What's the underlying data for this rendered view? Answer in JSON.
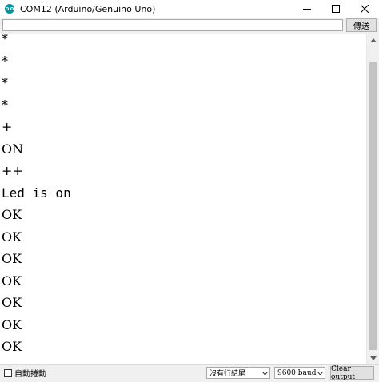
{
  "window": {
    "title": "COM12 (Arduino/Genuino Uno)",
    "controls": {
      "minimize": "—",
      "maximize": "☐",
      "close": "✕"
    }
  },
  "send_bar": {
    "input_value": "",
    "send_label": "傳送"
  },
  "output_lines": [
    "*",
    "*",
    "*",
    "*",
    "+",
    "ON",
    "++",
    "Led is on",
    "OK",
    "OK",
    "OK",
    "OK",
    "OK",
    "OK",
    "OK"
  ],
  "footer": {
    "autoscroll_label": "自動捲動",
    "autoscroll_checked": false,
    "line_ending": "沒有行結尾",
    "baud_rate": "9600 baud",
    "clear_label": "Clear output"
  },
  "colors": {
    "app_icon": "#00979c",
    "chrome": "#f0f0f0"
  }
}
